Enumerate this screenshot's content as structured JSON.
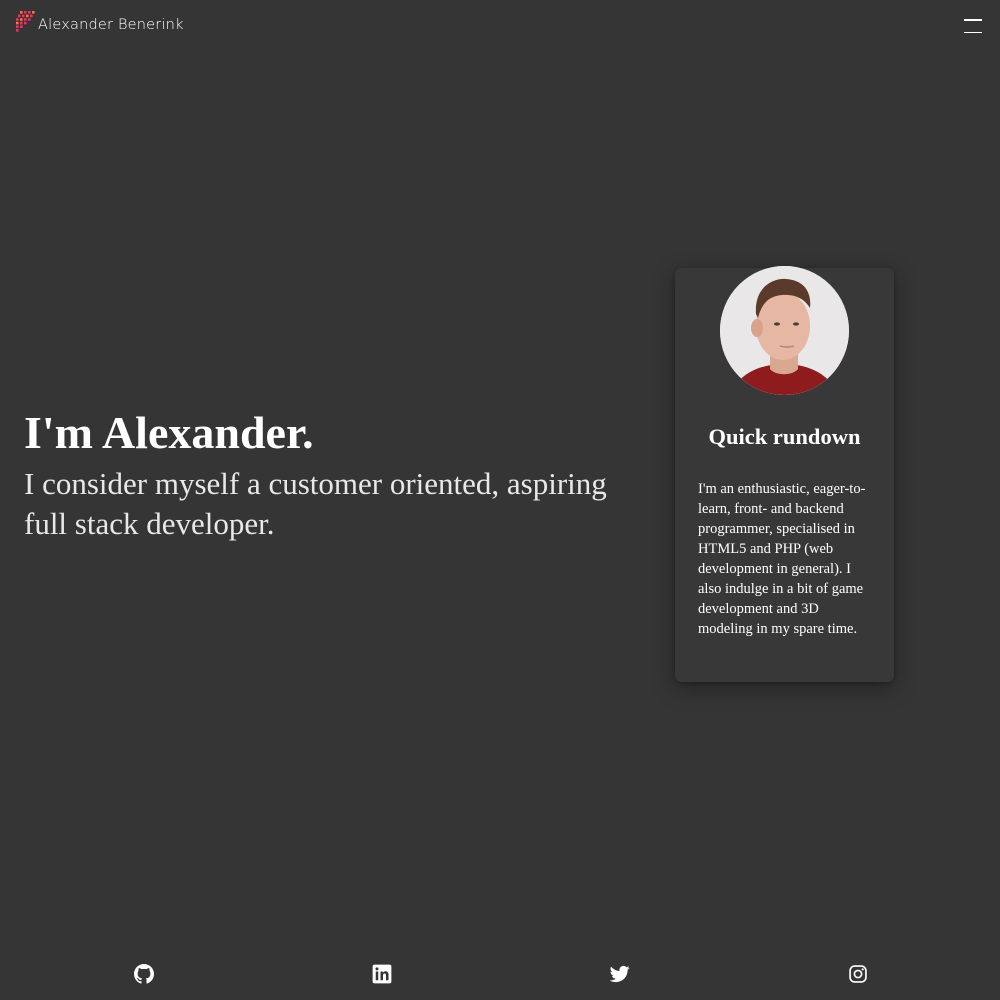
{
  "header": {
    "brand_name": "Alexander Benerink",
    "logo_icon": "pixel-logo-icon",
    "menu_icon": "hamburger-menu-icon"
  },
  "hero": {
    "title": "I'm Alexander.",
    "subtitle": "I consider myself a customer oriented, aspiring full stack developer."
  },
  "card": {
    "title": "Quick rundown",
    "text": "I'm an enthusiastic, eager-to-learn, front- and backend programmer, specialised in HTML5 and PHP (web development in general). I also indulge in a bit of game development and 3D modeling in my spare time.",
    "avatar_icon": "profile-photo"
  },
  "footer": {
    "social": [
      {
        "icon": "github-icon"
      },
      {
        "icon": "linkedin-icon"
      },
      {
        "icon": "twitter-icon"
      },
      {
        "icon": "instagram-icon"
      }
    ]
  },
  "colors": {
    "background": "#353535",
    "card_background": "#383838",
    "text": "#ffffff",
    "logo_accent_1": "#e8336b",
    "logo_accent_2": "#f27a3a"
  }
}
